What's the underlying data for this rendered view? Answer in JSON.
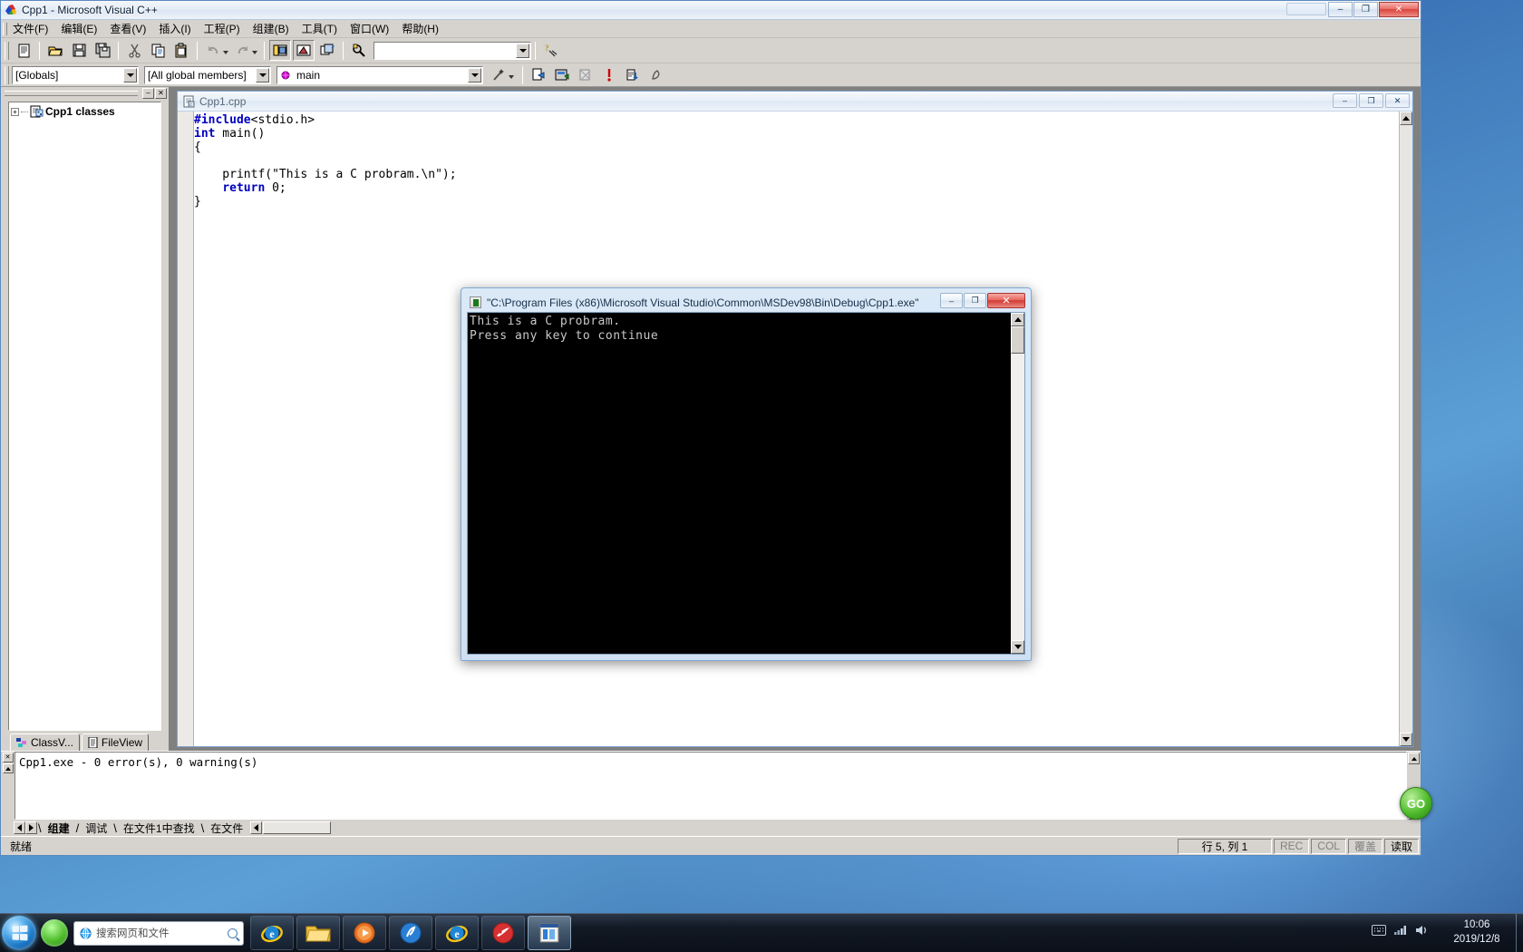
{
  "window": {
    "title": "Cpp1 - Microsoft Visual C++",
    "app_icon": "vc6-icon",
    "minimize_label": "–",
    "maximize_label": "❐",
    "close_label": "✕"
  },
  "menu": {
    "items": [
      {
        "label": "文件(F)",
        "name": "menu-file"
      },
      {
        "label": "编辑(E)",
        "name": "menu-edit"
      },
      {
        "label": "查看(V)",
        "name": "menu-view"
      },
      {
        "label": "插入(I)",
        "name": "menu-insert"
      },
      {
        "label": "工程(P)",
        "name": "menu-project"
      },
      {
        "label": "组建(B)",
        "name": "menu-build"
      },
      {
        "label": "工具(T)",
        "name": "menu-tools"
      },
      {
        "label": "窗口(W)",
        "name": "menu-window"
      },
      {
        "label": "帮助(H)",
        "name": "menu-help"
      }
    ]
  },
  "toolbar_standard": {
    "buttons": [
      {
        "name": "new-text-file-icon",
        "title": "New"
      },
      {
        "name": "open-folder-icon",
        "title": "Open"
      },
      {
        "name": "save-icon",
        "title": "Save"
      },
      {
        "name": "save-all-icon",
        "title": "Save All"
      },
      {
        "name": "cut-icon",
        "title": "Cut"
      },
      {
        "name": "copy-icon",
        "title": "Copy"
      },
      {
        "name": "paste-icon",
        "title": "Paste"
      },
      {
        "name": "undo-icon",
        "title": "Undo"
      },
      {
        "name": "redo-icon",
        "title": "Redo"
      },
      {
        "name": "workspace-window-icon",
        "title": "Workspace"
      },
      {
        "name": "output-window-icon",
        "title": "Output"
      },
      {
        "name": "window-list-icon",
        "title": "Windows"
      },
      {
        "name": "find-in-files-icon",
        "title": "Find in Files"
      }
    ],
    "search_value": "",
    "search_placeholder": "",
    "help_button": "context-help-icon"
  },
  "toolbar_wizardbar": {
    "class_combo": "[Globals]",
    "members_combo": "[All global members]",
    "function_combo": "main",
    "function_icon": "globe-member-icon",
    "wizard_icon": "wizard-wand-icon",
    "buttons": [
      {
        "name": "compile-icon"
      },
      {
        "name": "build-icon"
      },
      {
        "name": "stop-build-icon"
      },
      {
        "name": "execute-program-icon"
      },
      {
        "name": "go-debug-icon"
      },
      {
        "name": "insert-breakpoint-icon"
      }
    ]
  },
  "workspace_pane": {
    "header_buttons": [
      {
        "name": "pane-restore-button",
        "label": "–"
      },
      {
        "name": "pane-close-button",
        "label": "✕"
      }
    ],
    "tree": {
      "expander": "+",
      "icon": "class-folder-icon",
      "label": "Cpp1 classes"
    },
    "tabs": [
      {
        "label": "ClassV...",
        "name": "tab-classview",
        "icon": "classview-icon",
        "active": true
      },
      {
        "label": "FileView",
        "name": "tab-fileview",
        "icon": "fileview-icon",
        "active": false
      }
    ]
  },
  "document": {
    "tab_title": "Cpp1.cpp",
    "icon": "cpp-source-file-icon",
    "buttons": [
      {
        "name": "doc-minimize-button",
        "label": "–"
      },
      {
        "name": "doc-maximize-button",
        "label": "❐"
      },
      {
        "name": "doc-close-button",
        "label": "✕"
      }
    ],
    "code_lines": [
      "#include<stdio.h>",
      "int main()",
      "{",
      "    printf(\"This is a C probram.\\n\");",
      "    return 0;",
      "}"
    ],
    "code_html": "<span class=\"pp\">#include</span>&lt;stdio.h&gt;\n<span class=\"kw\">int</span> main()\n{\n\n    printf(\"This is a C probram.\\n\");\n    <span class=\"kw\">return</span> 0;\n}"
  },
  "console": {
    "title": "\"C:\\Program Files (x86)\\Microsoft Visual Studio\\Common\\MSDev98\\Bin\\Debug\\Cpp1.exe\"",
    "icon": "console-window-icon",
    "buttons": [
      {
        "name": "console-minimize-button",
        "label": "–"
      },
      {
        "name": "console-maximize-button",
        "label": "❐"
      },
      {
        "name": "console-close-button",
        "label": "✕"
      }
    ],
    "output_lines": [
      "This is a C probram.",
      "Press any key to continue"
    ],
    "output_text": "This is a C probram.\nPress any key to continue"
  },
  "output_pane": {
    "close_label": "✕",
    "text": "Cpp1.exe - 0 error(s), 0 warning(s)",
    "tabs": [
      {
        "label": "组建",
        "name": "output-tab-build",
        "active": true
      },
      {
        "label": "调试",
        "name": "output-tab-debug",
        "active": false
      },
      {
        "label": "在文件1中查找",
        "name": "output-tab-find-in-files-1",
        "active": false
      },
      {
        "label": "在文件",
        "name": "output-tab-find-in-files-2",
        "active": false
      }
    ]
  },
  "status_bar": {
    "ready": "就绪",
    "line_col": "行 5, 列 1",
    "rec": "REC",
    "col": "COL",
    "overwrite": "覆盖",
    "read": "读取"
  },
  "taskbar": {
    "start_label": "start-orb",
    "search_placeholder": "搜索网页和文件",
    "search_value": "",
    "items": [
      {
        "name": "taskbar-ie-icon",
        "active": false
      },
      {
        "name": "taskbar-explorer-icon",
        "active": false
      },
      {
        "name": "taskbar-media-player-icon",
        "active": false
      },
      {
        "name": "taskbar-kugou-icon",
        "active": false
      },
      {
        "name": "taskbar-edge-icon",
        "active": false
      },
      {
        "name": "taskbar-thunder-icon",
        "active": false
      },
      {
        "name": "taskbar-vc6-icon",
        "active": true
      }
    ],
    "clock_time": "10:06",
    "clock_date": "2019/12/8",
    "tray": [
      {
        "name": "tray-keyboard-icon"
      },
      {
        "name": "tray-network-icon"
      },
      {
        "name": "tray-volume-icon"
      },
      {
        "name": "tray-show-desktop-button"
      }
    ]
  },
  "colors": {
    "window_face": "#d6d3ce",
    "keyword_blue": "#0000c0",
    "console_bg": "#000000",
    "accent": "#4a7ab5"
  }
}
